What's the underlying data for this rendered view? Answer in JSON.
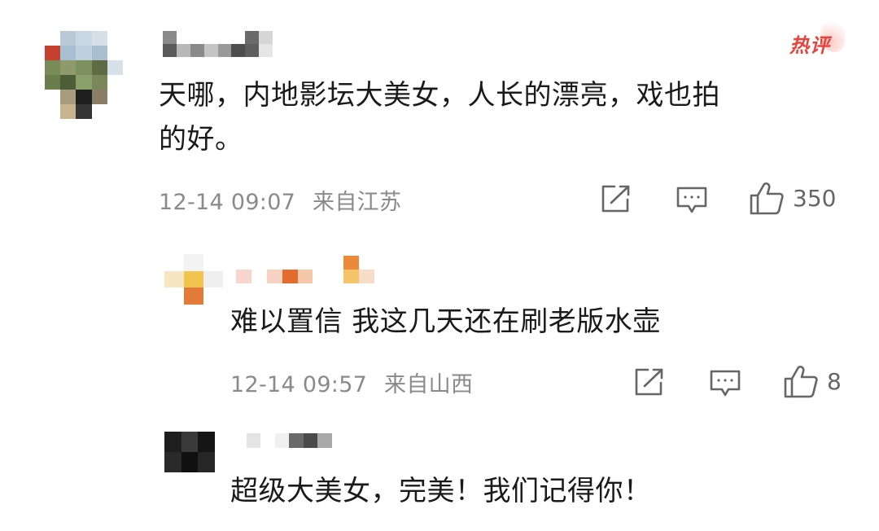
{
  "comments": [
    {
      "text": "天哪，内地影坛大美女，人长的漂亮，戏也拍的好。",
      "line1": "天哪，内地影坛大美女，人长的漂亮，戏也拍",
      "line2": "的好。",
      "time": "12-14 09:07",
      "location": "来自江苏",
      "likes": "350",
      "badge": "热评"
    },
    {
      "text": "难以置信 我这几天还在刷老版水壶",
      "time": "12-14 09:57",
      "location": "来自山西",
      "likes": "8"
    },
    {
      "text": "超级大美女，完美！我们记得你！"
    }
  ],
  "icons": {
    "share": "share-icon",
    "reply": "reply-icon",
    "like": "thumbs-up-icon"
  },
  "colors": {
    "text": "#1a1a1a",
    "meta": "#8a8a8a",
    "hot_badge": "#e8423d"
  }
}
